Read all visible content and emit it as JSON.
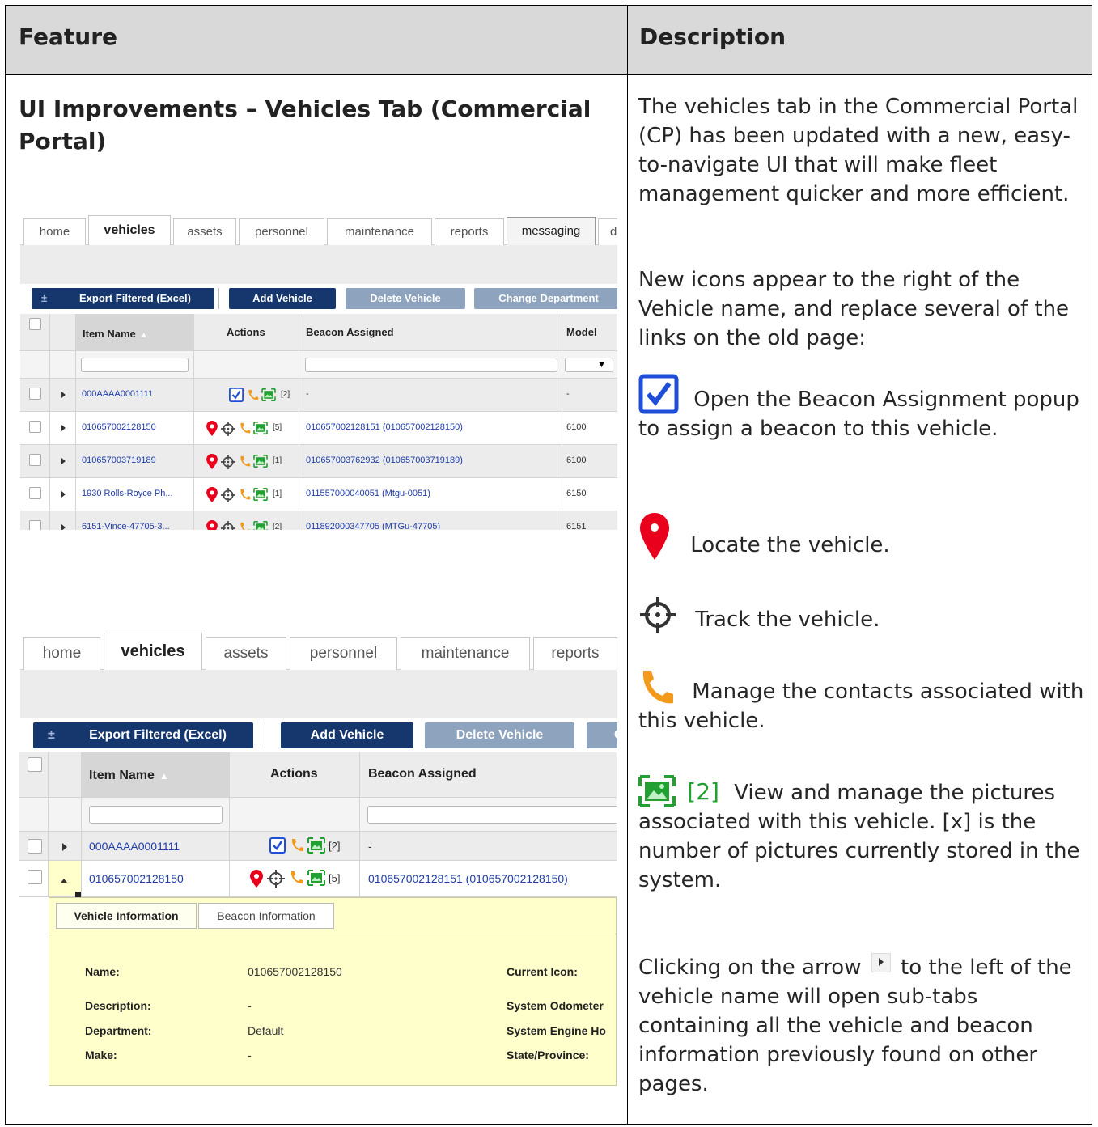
{
  "header": {
    "feature": "Feature",
    "description": "Description"
  },
  "feature_title": "UI Improvements – Vehicles Tab (Commercial Portal)",
  "description": {
    "intro": "The vehicles tab in the Commercial Portal (CP) has been updated with a new, easy-to-navigate UI that will make fleet management quicker and more efficient.",
    "icons_intro": "New icons appear to the right of the Vehicle name, and replace several of the links on the old page:",
    "beacon_assign": "Open the Beacon Assignment popup to assign a beacon to this vehicle.",
    "locate": "Locate the vehicle.",
    "track": "Track the vehicle.",
    "contacts": "Manage the contacts associated with this vehicle.",
    "pictures_count": "[2]",
    "pictures": "View and manage the pictures associated with this vehicle. [x] is the number of pictures currently stored in the system.",
    "arrow_pre": "Clicking on the arrow",
    "arrow_post": "to the left of the vehicle name will open sub-tabs containing all the vehicle and beacon information previously found on other pages."
  },
  "shot1": {
    "tabs": [
      "home",
      "vehicles",
      "assets",
      "personnel",
      "maintenance",
      "reports",
      "messaging",
      "di"
    ],
    "buttons": {
      "export": "Export Filtered (Excel)",
      "add": "Add Vehicle",
      "delete": "Delete Vehicle",
      "change": "Change Department"
    },
    "export_icon": "±",
    "columns": {
      "item_name": "Item Name",
      "actions": "Actions",
      "beacon": "Beacon Assigned",
      "model": "Model"
    },
    "select_value": "▼",
    "rows": [
      {
        "name": "000AAAA0001111",
        "count": "[2]",
        "beacon": "-",
        "model": "-"
      },
      {
        "name": "010657002128150",
        "count": "[5]",
        "beacon": "010657002128151 (010657002128150)",
        "model": "6100"
      },
      {
        "name": "010657003719189",
        "count": "[1]",
        "beacon": "010657003762932 (010657003719189)",
        "model": "6100"
      },
      {
        "name": "1930 Rolls-Royce Ph...",
        "count": "[1]",
        "beacon": "011557000040051 (Mtgu-0051)",
        "model": "6150"
      },
      {
        "name": "6151-Vince-47705-3...",
        "count": "[2]",
        "beacon": "011892000347705 (MTGu-47705)",
        "model": "6151"
      }
    ]
  },
  "shot2": {
    "tabs": [
      "home",
      "vehicles",
      "assets",
      "personnel",
      "maintenance",
      "reports"
    ],
    "buttons": {
      "export": "Export Filtered (Excel)",
      "add": "Add Vehicle",
      "delete": "Delete Vehicle",
      "change_partial": "C"
    },
    "export_icon": "±",
    "columns": {
      "item_name": "Item Name",
      "actions": "Actions",
      "beacon": "Beacon Assigned"
    },
    "rows": [
      {
        "name": "000AAAA0001111",
        "count": "[2]",
        "beacon": "-"
      },
      {
        "name": "010657002128150",
        "count": "[5]",
        "beacon": "010657002128151 (010657002128150)"
      }
    ],
    "panel_tabs": [
      "Vehicle Information",
      "Beacon Information"
    ],
    "fields": {
      "name_label": "Name:",
      "name_value": "010657002128150",
      "desc_label": "Description:",
      "desc_value": "-",
      "dept_label": "Department:",
      "dept_value": "Default",
      "make_label": "Make:",
      "make_value": "-",
      "icon_label": "Current Icon:",
      "odo_label": "System Odometer",
      "engine_label": "System Engine Ho",
      "state_label": "State/Province:"
    }
  },
  "colors": {
    "navy": "#16376e",
    "link": "#1f3ca8",
    "pin": "#e8001c",
    "phone": "#f39a1c",
    "picture": "#22a032",
    "check": "#1f4fd8"
  },
  "icons": [
    "check-icon",
    "location-pin-icon",
    "crosshair-icon",
    "phone-icon",
    "picture-icon",
    "expand-arrow-icon"
  ]
}
